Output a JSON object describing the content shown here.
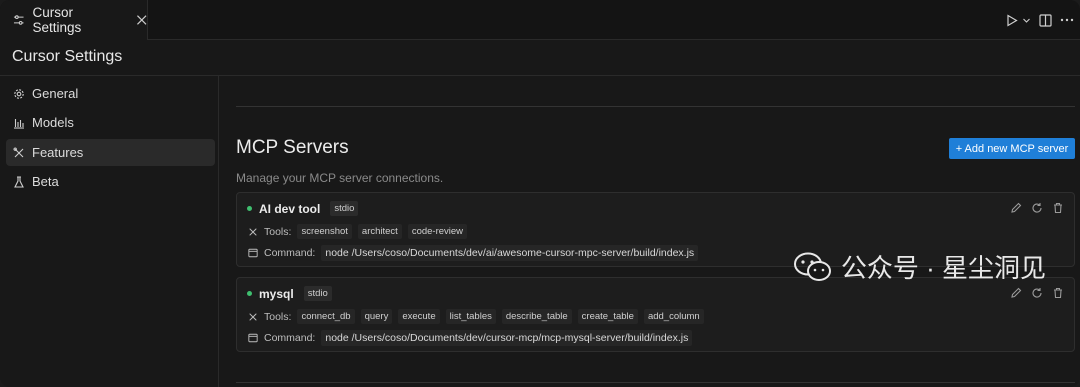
{
  "tab": {
    "title": "Cursor Settings"
  },
  "header": {
    "title": "Cursor Settings"
  },
  "sidebar": {
    "items": [
      {
        "label": "General",
        "icon": "gear-icon"
      },
      {
        "label": "Models",
        "icon": "bar-chart-icon"
      },
      {
        "label": "Features",
        "icon": "tools-icon",
        "active": true
      },
      {
        "label": "Beta",
        "icon": "flask-icon"
      }
    ]
  },
  "mcp": {
    "title": "MCP Servers",
    "subtitle": "Manage your MCP server connections.",
    "add_button": "+ Add new MCP server",
    "tools_label": "Tools:",
    "command_label": "Command:",
    "servers": [
      {
        "name": "AI dev tool",
        "transport": "stdio",
        "status_color": "#3fbf6f",
        "tools": [
          "screenshot",
          "architect",
          "code-review"
        ],
        "command": "node /Users/coso/Documents/dev/ai/awesome-cursor-mpc-server/build/index.js"
      },
      {
        "name": "mysql",
        "transport": "stdio",
        "status_color": "#3fbf6f",
        "tools": [
          "connect_db",
          "query",
          "execute",
          "list_tables",
          "describe_table",
          "create_table",
          "add_column"
        ],
        "command": "node /Users/coso/Documents/dev/cursor-mcp/mcp-mysql-server/build/index.js"
      }
    ]
  },
  "watermark": {
    "text": "公众号 · 星尘洞见"
  },
  "colors": {
    "accent": "#1f7fd8",
    "status_green": "#3fbf6f"
  }
}
